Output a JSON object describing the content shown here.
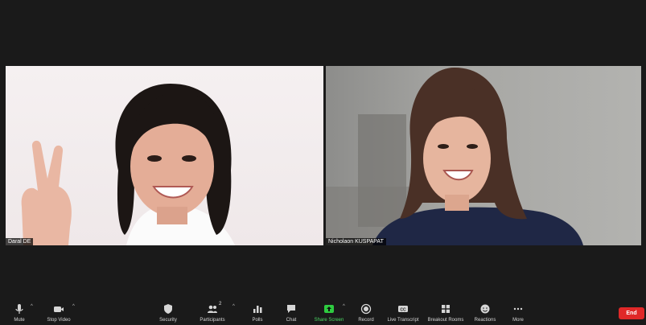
{
  "participants": [
    {
      "name": "Daral DE"
    },
    {
      "name": "Nicholaon KUSPAPAT"
    }
  ],
  "toolbar": {
    "mute": {
      "label": "Mute",
      "icon": "microphone-icon"
    },
    "video": {
      "label": "Stop Video",
      "icon": "video-camera-icon"
    },
    "security": {
      "label": "Security",
      "icon": "shield-icon"
    },
    "participants": {
      "label": "Participants",
      "count": "2",
      "icon": "people-icon"
    },
    "polls": {
      "label": "Polls",
      "icon": "bar-chart-icon"
    },
    "chat": {
      "label": "Chat",
      "icon": "chat-bubble-icon"
    },
    "share": {
      "label": "Share Screen",
      "icon": "share-arrow-icon",
      "color": "#4cd964"
    },
    "record": {
      "label": "Record",
      "icon": "record-icon"
    },
    "transcript": {
      "label": "Live Transcript",
      "badge": "CC",
      "icon": "cc-icon"
    },
    "breakout": {
      "label": "Breakout Rooms",
      "icon": "grid-icon"
    },
    "reactions": {
      "label": "Reactions",
      "icon": "smiley-icon"
    },
    "more": {
      "label": "More",
      "icon": "ellipsis-icon"
    },
    "end": {
      "label": "End",
      "color": "#e02828"
    }
  }
}
